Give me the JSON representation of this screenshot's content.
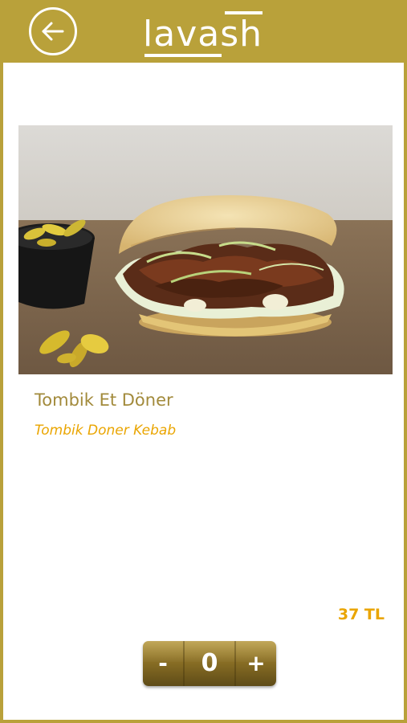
{
  "header": {
    "logo_text": "lavash",
    "back_icon": "arrow-left-icon"
  },
  "product": {
    "name": "Tombik Et Döner",
    "subtitle": "Tombik Doner Kebab",
    "price": "37 TL",
    "image": "doner-sandwich-photo"
  },
  "stepper": {
    "minus_label": "-",
    "quantity": "0",
    "plus_label": "+"
  },
  "colors": {
    "brand_gold": "#b9a13a",
    "name_text": "#a28a3b",
    "accent_orange": "#eaa500",
    "stepper_dark": "#5e4b17"
  }
}
